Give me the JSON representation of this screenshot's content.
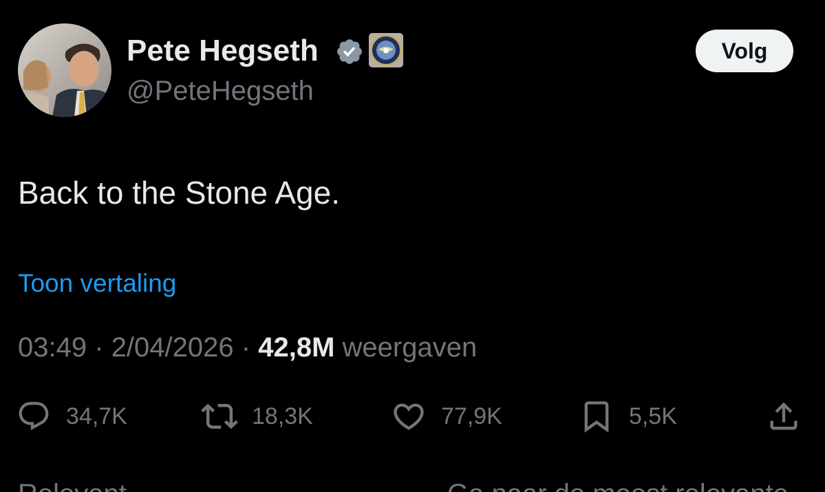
{
  "author": {
    "display_name": "Pete Hegseth",
    "handle": "@PeteHegseth",
    "verified_color": "#8b98a5"
  },
  "header": {
    "follow_label": "Volg"
  },
  "tweet": {
    "text": "Back to the Stone Age.",
    "translate_label": "Toon vertaling",
    "time": "03:49",
    "separator": "·",
    "date": "2/04/2026",
    "views_count": "42,8M",
    "views_label": "weergaven"
  },
  "actions": {
    "replies": "34,7K",
    "reposts": "18,3K",
    "likes": "77,9K",
    "bookmarks": "5,5K"
  },
  "bottom": {
    "left_text": "Relevant",
    "right_text": "Ga naar de meest relevante"
  },
  "colors": {
    "background": "#000000",
    "text_primary": "#e7e9ea",
    "text_secondary": "#71767b",
    "link": "#1d9bf0",
    "button_bg": "#eff3f4"
  }
}
